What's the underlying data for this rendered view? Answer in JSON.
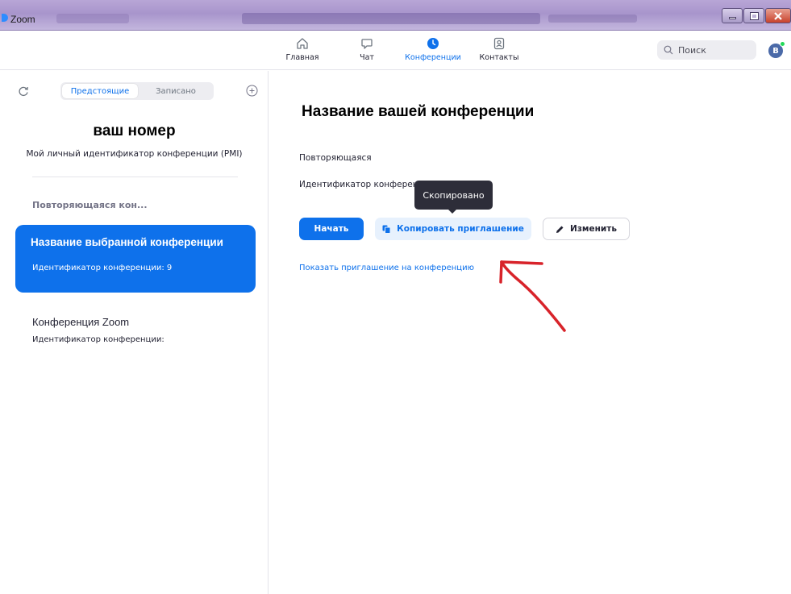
{
  "window": {
    "title": "Zoom",
    "colors": {
      "titlebar": "#b8a6d6",
      "close": "#c8422c"
    }
  },
  "topnav": {
    "items": [
      {
        "label": "Главная",
        "icon": "home-icon"
      },
      {
        "label": "Чат",
        "icon": "chat-bubble-icon"
      },
      {
        "label": "Конференции",
        "icon": "clock-icon",
        "active": true
      },
      {
        "label": "Контакты",
        "icon": "contact-card-icon"
      }
    ],
    "search_label": "Поиск",
    "avatar_initial": "B"
  },
  "sidebar": {
    "tabs": {
      "upcoming": "Предстоящие",
      "recorded": "Записано",
      "active": "upcoming"
    },
    "pmi_number": "ваш номер",
    "pmi_label": "Мой личный идентификатор конференции (PMI)",
    "section_header": "Повторяющаяся кон...",
    "selected_meeting": {
      "title": "Название выбранной конференции",
      "id_text": "Идентификатор конференции: 9"
    },
    "meeting": {
      "title": "Конференция Zoom",
      "id_text": "Идентификатор конференции:"
    }
  },
  "main": {
    "title": "Название вашей конференции",
    "recurring_label": "Повторяющаяся",
    "meeting_id_label": "Идентификатор конференции",
    "tooltip": "Скопировано",
    "buttons": {
      "start": "Начать",
      "copy_invite": "Копировать приглашение",
      "edit": "Изменить"
    },
    "show_invite_link": "Показать приглашение на конференцию"
  },
  "colors": {
    "accent": "#0e71eb",
    "annotation": "#d8232a"
  }
}
